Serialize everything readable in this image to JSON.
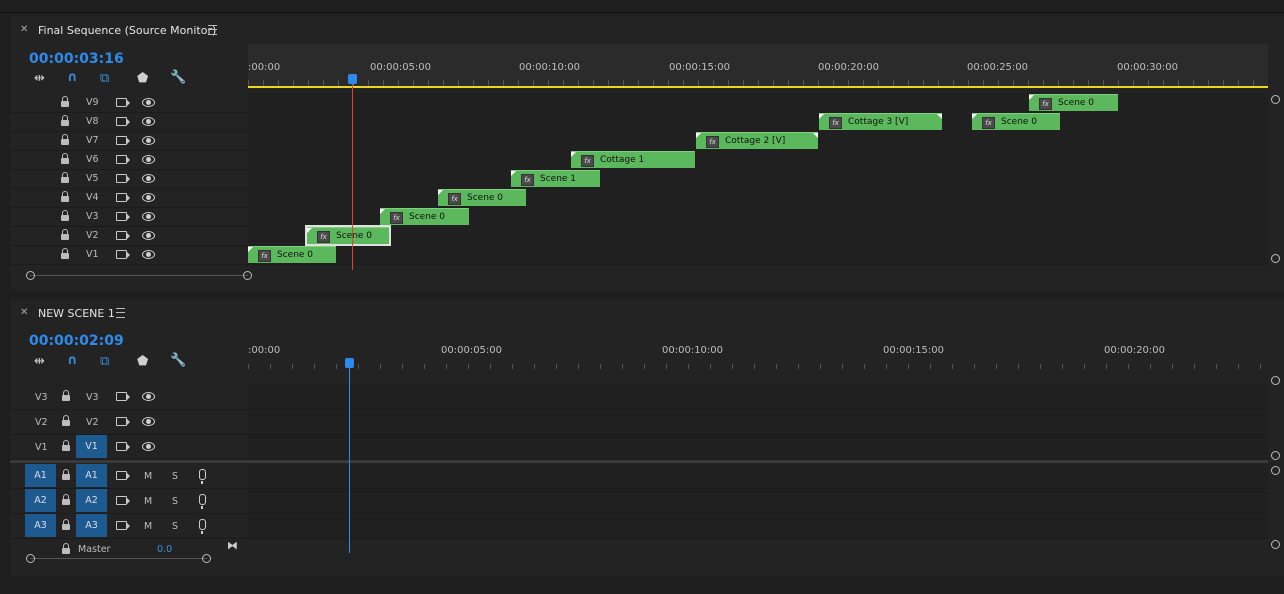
{
  "top_panel": {
    "title": "Final Sequence (Source Monitor)",
    "timecode": "00:00:03:16",
    "ruler_labels": [
      ":00:00",
      "00:00:05:00",
      "00:00:10:00",
      "00:00:15:00",
      "00:00:20:00",
      "00:00:25:00",
      "00:00:30:00"
    ],
    "tracks": [
      "V9",
      "V8",
      "V7",
      "V6",
      "V5",
      "V4",
      "V3",
      "V2",
      "V1"
    ],
    "clips": [
      {
        "track": "V9",
        "label": "Scene 0"
      },
      {
        "track": "V8",
        "label": "Cottage 3 [V]"
      },
      {
        "track": "V8",
        "label": "Scene 0"
      },
      {
        "track": "V7",
        "label": "Cottage 2 [V]"
      },
      {
        "track": "V6",
        "label": "Cottage 1"
      },
      {
        "track": "V5",
        "label": "Scene 1"
      },
      {
        "track": "V4",
        "label": "Scene 0"
      },
      {
        "track": "V3",
        "label": "Scene 0"
      },
      {
        "track": "V2",
        "label": "Scene 0"
      },
      {
        "track": "V1",
        "label": "Scene 0"
      }
    ]
  },
  "bottom_panel": {
    "title": "NEW SCENE 1",
    "timecode": "00:00:02:09",
    "ruler_labels": [
      ":00:00",
      "00:00:05:00",
      "00:00:10:00",
      "00:00:15:00",
      "00:00:20:00"
    ],
    "video_tracks": [
      {
        "source": "V3",
        "target": "V3"
      },
      {
        "source": "V2",
        "target": "V2"
      },
      {
        "source": "V1",
        "target": "V1"
      }
    ],
    "audio_tracks": [
      {
        "source": "A1",
        "target": "A1"
      },
      {
        "source": "A2",
        "target": "A2"
      },
      {
        "source": "A3",
        "target": "A3"
      }
    ],
    "mute_label": "M",
    "solo_label": "S",
    "master_label": "Master",
    "master_value": "0.0"
  },
  "colors": {
    "accent": "#2d8ceb",
    "clip": "#5cb85c",
    "playhead_top": "#e0452a",
    "playhead_bottom": "#2d8ceb"
  }
}
